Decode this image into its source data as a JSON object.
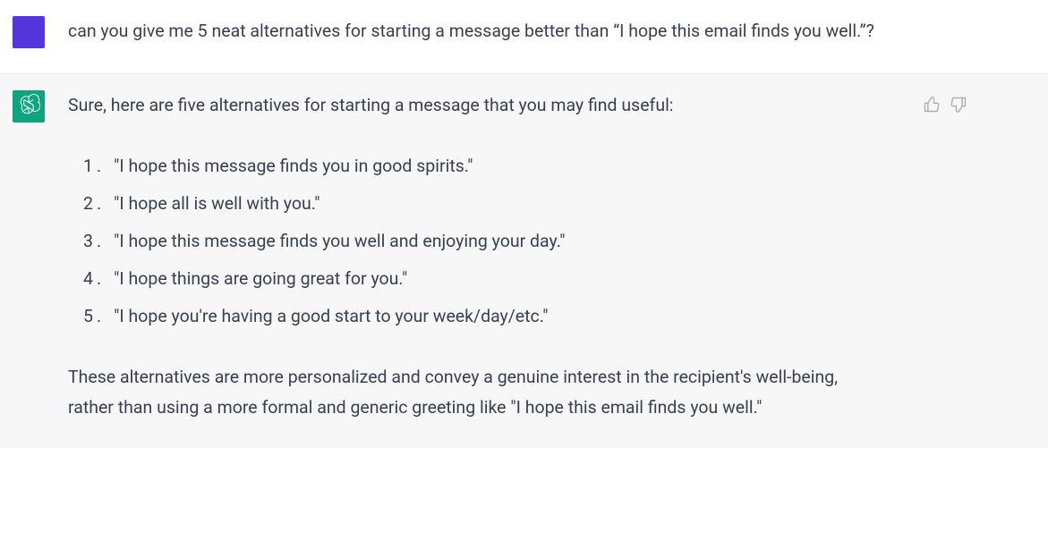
{
  "user": {
    "message": "can you give me 5 neat alternatives for starting a message better than  “I hope this email finds you well.”?"
  },
  "assistant": {
    "intro": "Sure, here are five alternatives for starting a message that you may find useful:",
    "items": [
      "\"I hope this message finds you in good spirits.\"",
      "\"I hope all is well with you.\"",
      "\"I hope this message finds you well and enjoying your day.\"",
      "\"I hope things are going great for you.\"",
      "\"I hope you're having a good start to your week/day/etc.\""
    ],
    "closing": "These alternatives are more personalized and convey a genuine interest in the recipient's well-being, rather than using a more formal and generic greeting like \"I hope this email finds you well.\""
  },
  "list_numbers": [
    "1",
    "2",
    "3",
    "4",
    "5"
  ]
}
